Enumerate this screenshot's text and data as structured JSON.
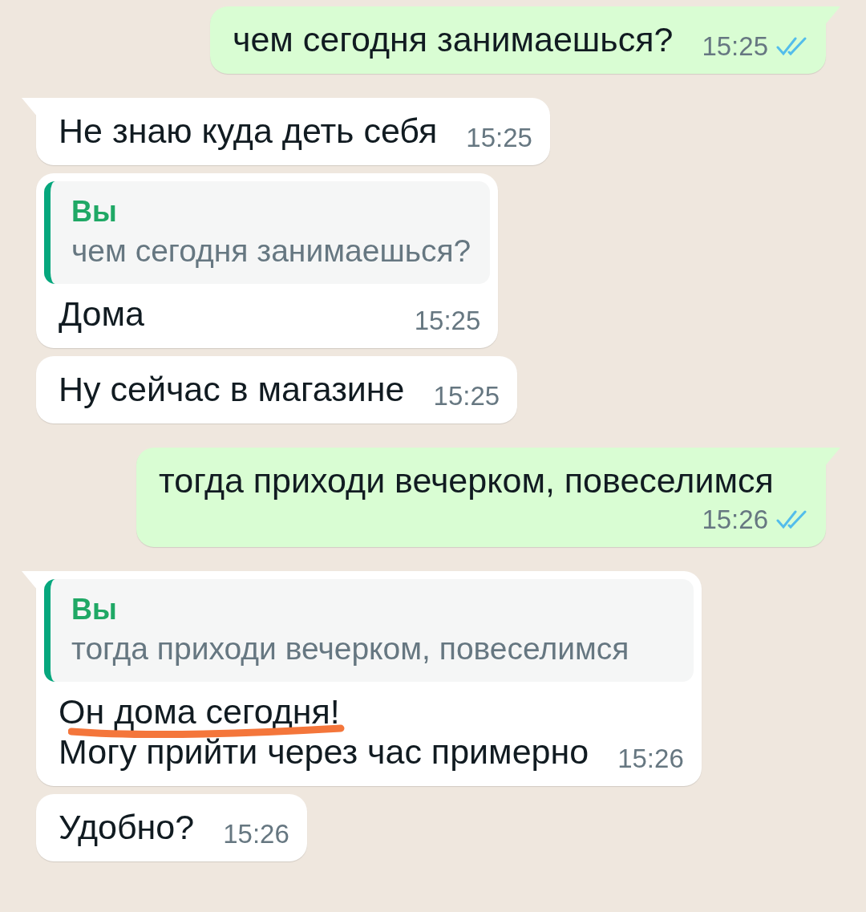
{
  "messages": [
    {
      "outgoing": true,
      "tail": true,
      "text": "чем сегодня занимаешься?",
      "time": "15:25",
      "read": true
    },
    {
      "outgoing": false,
      "tail": true,
      "text": "Не знаю куда деть себя",
      "time": "15:25"
    },
    {
      "outgoing": false,
      "tail": false,
      "reply": {
        "author": "Вы",
        "text": "чем сегодня занимаешься?"
      },
      "text": "Дома",
      "time": "15:25"
    },
    {
      "outgoing": false,
      "tail": false,
      "text": "Ну сейчас в магазине",
      "time": "15:25"
    },
    {
      "outgoing": true,
      "tail": true,
      "text": "тогда приходи вечерком, повеселимся",
      "time": "15:26",
      "read": true
    },
    {
      "outgoing": false,
      "tail": true,
      "reply": {
        "author": "Вы",
        "text": "тогда приходи вечерком, повеселимся"
      },
      "text": "Он дома сегодня!\nМогу прийти через час примерно",
      "time": "15:26",
      "underlined": true
    },
    {
      "outgoing": false,
      "tail": false,
      "text": "Удобно?",
      "time": "15:26"
    }
  ]
}
